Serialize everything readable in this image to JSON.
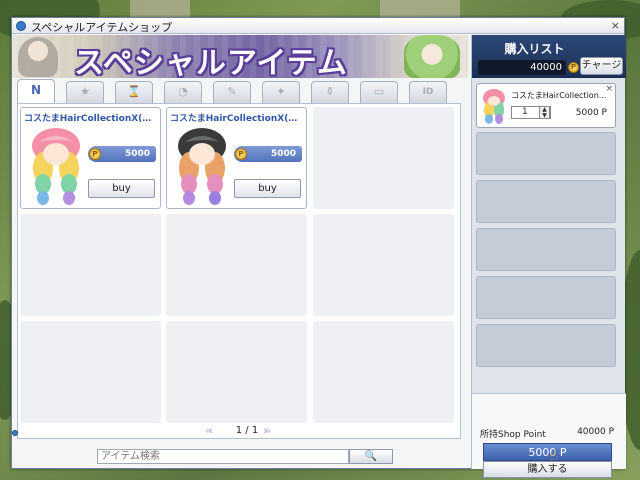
{
  "window": {
    "title": "スペシャルアイテムショップ",
    "close": "×"
  },
  "banner": {
    "title": "スペシャルアイテム"
  },
  "tabs": [
    {
      "label": "N",
      "icon": "new-icon"
    },
    {
      "label": "★",
      "icon": "star-icon"
    },
    {
      "label": "⌛",
      "icon": "hourglass-icon"
    },
    {
      "label": "◔",
      "icon": "clock-icon"
    },
    {
      "label": "✎",
      "icon": "shield-icon"
    },
    {
      "label": "✦",
      "icon": "sparkle-icon"
    },
    {
      "label": "⚱",
      "icon": "potion-icon"
    },
    {
      "label": "▭",
      "icon": "box-icon"
    },
    {
      "label": "ID",
      "icon": "id-card-icon"
    }
  ],
  "items": [
    {
      "name": "コスたまHairCollectionX(明...",
      "price": "5000",
      "buy_label": "buy",
      "coin": "P"
    },
    {
      "name": "コスたまHairCollectionX(暗...",
      "price": "5000",
      "buy_label": "buy",
      "coin": "P"
    }
  ],
  "pager": {
    "prev": "«‹",
    "text": "1 / 1",
    "next": "›»"
  },
  "search": {
    "placeholder": "アイテム検索",
    "button_icon": "🔍"
  },
  "cart": {
    "title": "購入リスト",
    "amount": "40000",
    "coin": "P",
    "charge_label": "チャージ",
    "item": {
      "name": "コスたまHairCollection...",
      "qty": "1",
      "price": "5000 P",
      "close": "×"
    },
    "shop_point_label": "所持Shop Point",
    "shop_point_value": "40000 P",
    "total": "5000 P",
    "buy_label": "購入する"
  },
  "colors": {
    "accent": "#3d62ad",
    "header": "#1b2f55",
    "banner_title_outline": "#5a3d9b"
  }
}
